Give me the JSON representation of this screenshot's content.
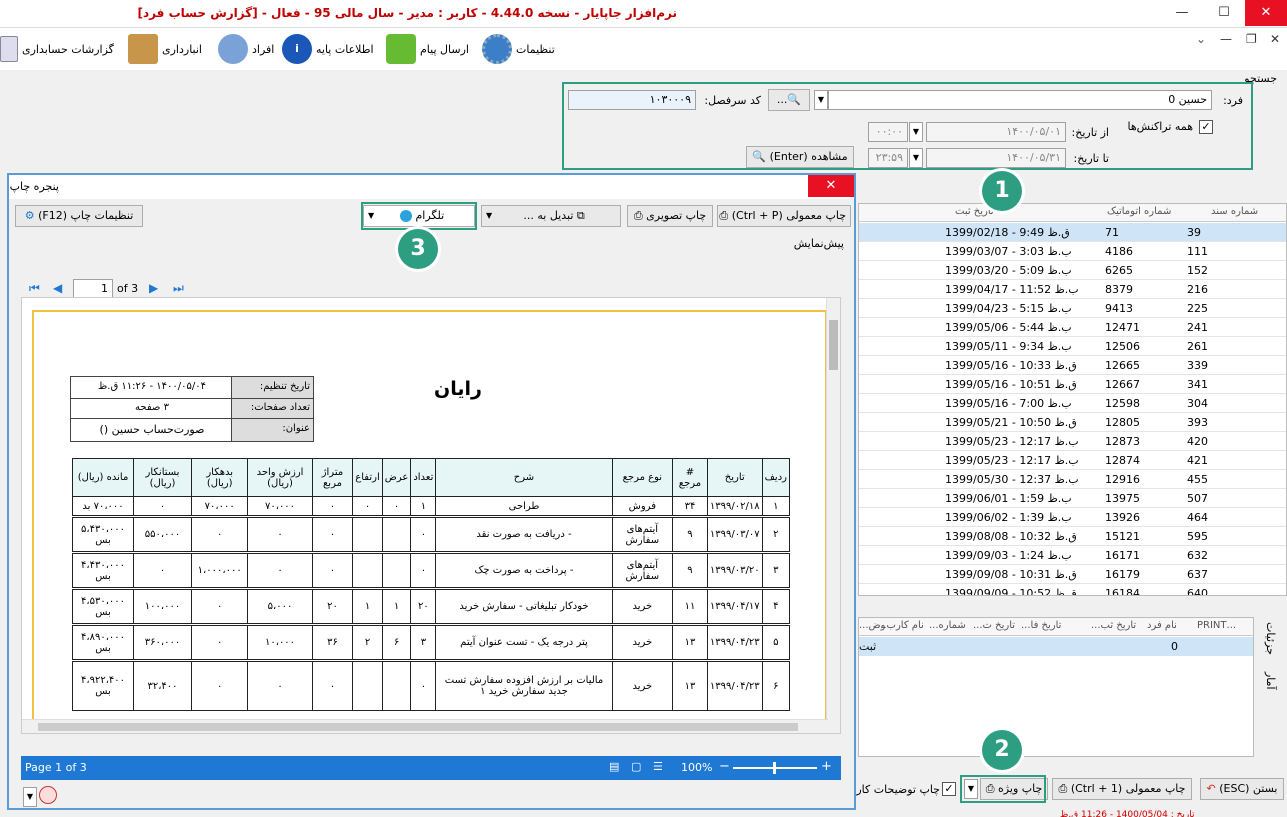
{
  "window": {
    "title": "نرم‌افزار جاپایار - نسخه 4.44.0 - کاربر : مدیر - سال مالی 95 - فعال - [گزارش حساب فرد]",
    "minimize": "—",
    "maximize": "☐",
    "close": "✕",
    "inner_min": "—",
    "inner_restore": "❐",
    "inner_close": "✕",
    "inner_chevron": "⌄"
  },
  "toolbar": {
    "items": [
      {
        "label": "گزارشات حسابداری",
        "icon": "report-icon"
      },
      {
        "label": "انبارداری",
        "icon": "box-icon"
      },
      {
        "label": "افراد",
        "icon": "person-icon"
      },
      {
        "label": "اطلاعات پایه",
        "icon": "info-icon"
      },
      {
        "label": "ارسال پیام",
        "icon": "message-icon"
      },
      {
        "label": "تنظیمات",
        "icon": "gear-icon"
      }
    ]
  },
  "search": {
    "section_label": "جستجو",
    "person_label": "فرد:",
    "person_value": "حسین 0",
    "code_label": "کد سرفصل:",
    "code_value": "۱۰۳۰۰۰۹",
    "dots": "...",
    "all_tx_label": "همه تراکنش‌ها",
    "from_label": "از تاریخ:",
    "from_date": "۱۴۰۰/۰۵/۰۱",
    "from_time": "۰۰:۰۰",
    "to_label": "تا تاریخ:",
    "to_date": "۱۴۰۰/۰۵/۳۱",
    "to_time": "۲۳:۵۹",
    "view_button": "مشاهده (Enter)"
  },
  "grid": {
    "headers": [
      "شماره سند",
      "شماره اتوماتیک",
      "تاریخ ثبت"
    ],
    "rows": [
      {
        "doc": "39",
        "auto": "71",
        "date": "1399/02/18 - 9:49 ق.ظ"
      },
      {
        "doc": "111",
        "auto": "4186",
        "date": "1399/03/07 - 3:03 ب.ظ"
      },
      {
        "doc": "152",
        "auto": "6265",
        "date": "1399/03/20 - 5:09 ب.ظ"
      },
      {
        "doc": "216",
        "auto": "8379",
        "date": "1399/04/17 - 11:52 ب.ظ"
      },
      {
        "doc": "225",
        "auto": "9413",
        "date": "1399/04/23 - 5:15 ب.ظ"
      },
      {
        "doc": "241",
        "auto": "12471",
        "date": "1399/05/06 - 5:44 ب.ظ"
      },
      {
        "doc": "261",
        "auto": "12506",
        "date": "1399/05/11 - 9:34 ب.ظ"
      },
      {
        "doc": "339",
        "auto": "12665",
        "date": "1399/05/16 - 10:33 ق.ظ"
      },
      {
        "doc": "341",
        "auto": "12667",
        "date": "1399/05/16 - 10:51 ق.ظ"
      },
      {
        "doc": "304",
        "auto": "12598",
        "date": "1399/05/16 - 7:00 ب.ظ"
      },
      {
        "doc": "393",
        "auto": "12805",
        "date": "1399/05/21 - 10:50 ق.ظ"
      },
      {
        "doc": "420",
        "auto": "12873",
        "date": "1399/05/23 - 12:17 ب.ظ"
      },
      {
        "doc": "421",
        "auto": "12874",
        "date": "1399/05/23 - 12:17 ب.ظ"
      },
      {
        "doc": "455",
        "auto": "12916",
        "date": "1399/05/30 - 12:37 ب.ظ"
      },
      {
        "doc": "507",
        "auto": "13975",
        "date": "1399/06/01 - 1:59 ب.ظ"
      },
      {
        "doc": "464",
        "auto": "13926",
        "date": "1399/06/02 - 1:39 ب.ظ"
      },
      {
        "doc": "595",
        "auto": "15121",
        "date": "1399/08/08 - 10:32 ق.ظ"
      },
      {
        "doc": "632",
        "auto": "16171",
        "date": "1399/09/03 - 1:24 ب.ظ"
      },
      {
        "doc": "637",
        "auto": "16179",
        "date": "1399/09/08 - 10:31 ق.ظ"
      },
      {
        "doc": "640",
        "auto": "16184",
        "date": "1399/09/09 - 10:52 ق.ظ"
      }
    ]
  },
  "grid2": {
    "headers": [
      "...PRINT",
      "نام فرد",
      "تاریخ ثب...",
      "تاریخ فا...",
      "تاریخ ت...",
      "شماره...",
      "نام کارب...",
      "وض..."
    ],
    "row_value": "0",
    "row_status": "ثبت",
    "tab_details": "جزئیات",
    "tab_stats": "آمار"
  },
  "bottom": {
    "close_button": "بستن (ESC)",
    "normal_print": "چاپ معمولی (Ctrl + 1)",
    "special_print": "چاپ ویژه",
    "desc_print": "چاپ توضیحات کار"
  },
  "print_window": {
    "title": "پنجره چاپ",
    "close": "✕",
    "print_normal": "چاپ معمولی (Ctrl + P)",
    "print_image": "چاپ تصویری",
    "convert": "تبدیل به ...",
    "telegram": "تلگرام",
    "print_settings": "تنظیمات چاپ (F12)",
    "preview_label": "پیش‌نمایش",
    "page_input": "1",
    "page_of": "of 3",
    "status_page": "Page 1 of 3",
    "zoom": "100%",
    "minus": "−",
    "plus": "+"
  },
  "report": {
    "company": "رایان",
    "date_label": "تاریخ تنظیم:",
    "date_value": "۱۴۰۰/۰۵/۰۴ - ۱۱:۲۶ ق.ظ",
    "pages_label": "تعداد صفحات:",
    "pages_value": "۳ صفحه",
    "title_label": "عنوان:",
    "title_value": "صورت‌حساب حسین ()",
    "headers": [
      "ردیف",
      "تاریخ",
      "# مرجع",
      "نوع مرجع",
      "شرح",
      "تعداد",
      "عرض",
      "ارتفاع",
      "متراژ مربع",
      "ارزش واحد (ریال)",
      "بدهکار (ریال)",
      "بستانکار (ریال)",
      "مانده (ریال)"
    ],
    "rows": [
      [
        "۱",
        "۱۳۹۹/۰۲/۱۸",
        "۳۴",
        "فروش",
        "طراحی",
        "۱",
        "۰",
        "۰",
        "۰",
        "۷۰،۰۰۰",
        "۷۰،۰۰۰",
        "۰",
        "۷۰،۰۰۰ بد"
      ],
      [
        "۲",
        "۱۳۹۹/۰۳/۰۷",
        "۹",
        "آیتم‌های سفارش",
        "- دریافت به صورت نقد",
        "۰",
        "",
        "",
        "۰",
        "۰",
        "۰",
        "۵۵۰،۰۰۰",
        "۵،۴۳۰،۰۰۰ بس"
      ],
      [
        "۳",
        "۱۳۹۹/۰۳/۲۰",
        "۹",
        "آیتم‌های سفارش",
        "- پرداخت به صورت چک",
        "۰",
        "",
        "",
        "۰",
        "۰",
        "۱،۰۰۰،۰۰۰",
        "۰",
        "۴،۴۳۰،۰۰۰ بس"
      ],
      [
        "۴",
        "۱۳۹۹/۰۴/۱۷",
        "۱۱",
        "خرید",
        "خودکار تبلیغاتی - سفارش خرید",
        "۲۰",
        "۱",
        "۱",
        "۲۰",
        "۵،۰۰۰",
        "۰",
        "۱۰۰،۰۰۰",
        "۴،۵۳۰،۰۰۰ بس"
      ],
      [
        "۵",
        "۱۳۹۹/۰۴/۲۳",
        "۱۳",
        "خرید",
        "پتر درجه یک - تست عنوان آیتم",
        "۳",
        "۶",
        "۲",
        "۳۶",
        "۱۰،۰۰۰",
        "۰",
        "۳۶۰،۰۰۰",
        "۴،۸۹۰،۰۰۰ بس"
      ],
      [
        "۶",
        "۱۳۹۹/۰۴/۲۳",
        "۱۳",
        "خرید",
        "مالیات بر ارزش افزوده سفارش تست جدید سفارش خرید ۱",
        "۰",
        "",
        "",
        "۰",
        "۰",
        "۰",
        "۳۲،۴۰۰",
        "۴،۹۲۲،۴۰۰ بس"
      ]
    ]
  },
  "callouts": {
    "one": "1",
    "two": "2",
    "three": "3"
  },
  "footer": {
    "partial": "تاریخ : 1400/05/04 - 11:26 ق.ظ"
  },
  "colors": {
    "accent": "#2e9e82",
    "title_red": "#c00000",
    "status_blue": "#1e78d4"
  }
}
